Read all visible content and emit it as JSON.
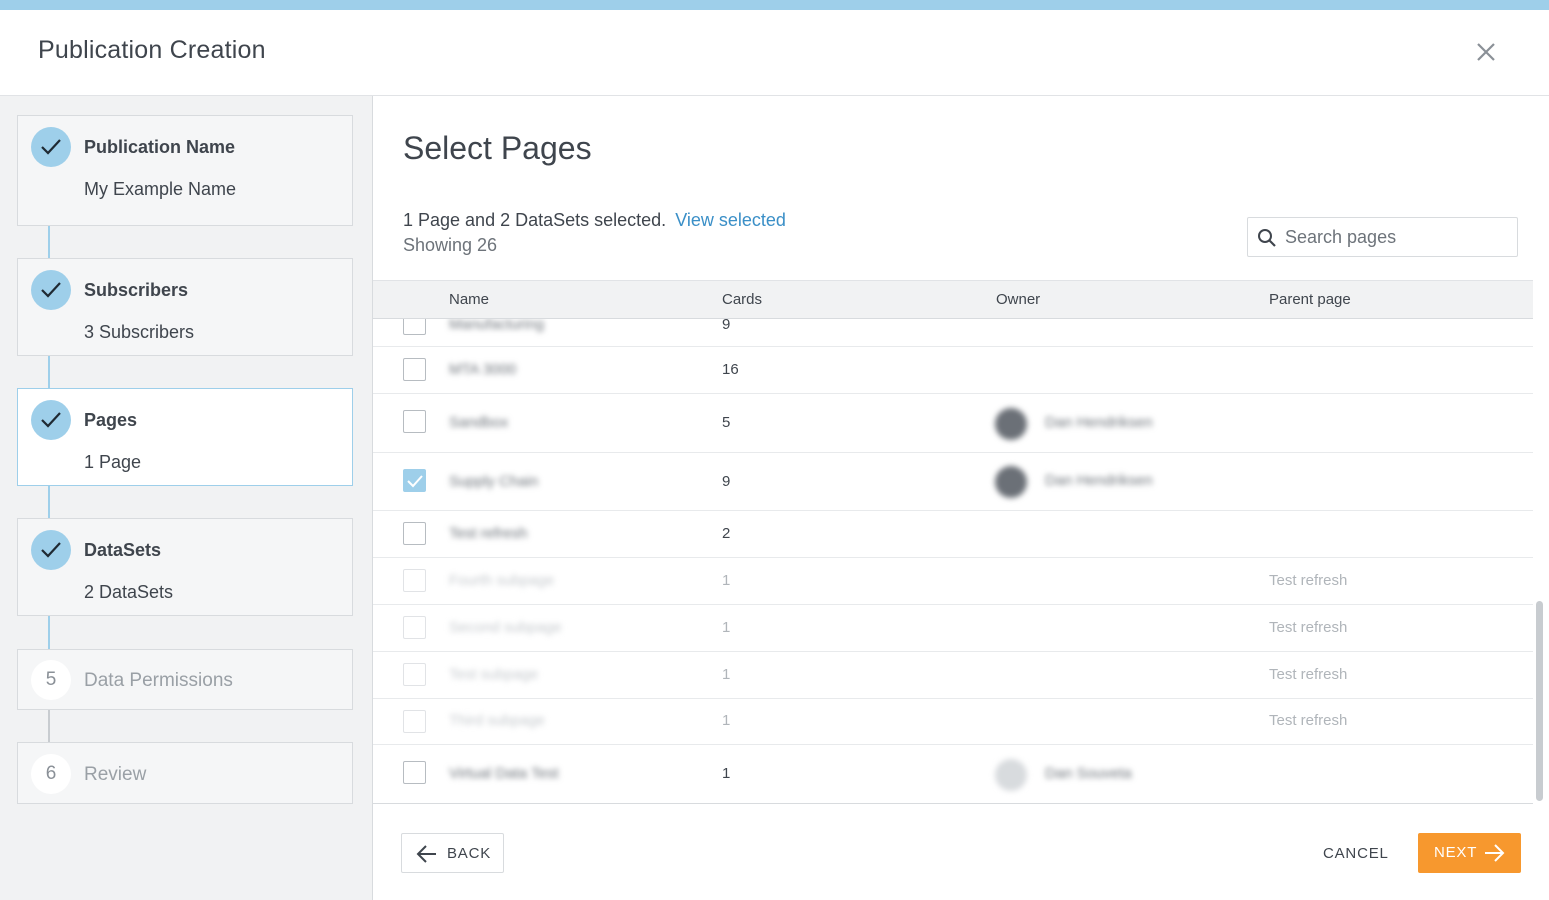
{
  "app": {
    "title": "Publication Creation",
    "close_icon": "close-icon"
  },
  "colors": {
    "accent": "#9ecfea",
    "link": "#3a8fc7",
    "primary_button": "#f7982e"
  },
  "steps": [
    {
      "status": "complete",
      "title": "Publication Name",
      "subtitle": "My Example Name"
    },
    {
      "status": "complete",
      "title": "Subscribers",
      "subtitle": "3 Subscribers"
    },
    {
      "status": "complete",
      "title": "Pages",
      "subtitle": "1 Page",
      "active": true
    },
    {
      "status": "complete",
      "title": "DataSets",
      "subtitle": "2 DataSets"
    },
    {
      "status": "pending",
      "number": "5",
      "title": "Data Permissions"
    },
    {
      "status": "pending",
      "number": "6",
      "title": "Review"
    }
  ],
  "main": {
    "title": "Select Pages",
    "selection_summary": "1 Page and 2 DataSets selected.",
    "view_selected_link": "View selected",
    "showing": "Showing 26",
    "search_placeholder": "Search pages"
  },
  "table": {
    "columns": [
      "Name",
      "Cards",
      "Owner",
      "Parent page"
    ],
    "rows": [
      {
        "name": "Manufacturing",
        "cards": "9",
        "owner": "",
        "parent": "",
        "checked": false
      },
      {
        "name": "MTA 3000",
        "cards": "16",
        "owner": "",
        "parent": "",
        "checked": false
      },
      {
        "name": "Sandbox",
        "cards": "5",
        "owner": "Dan Hendriksen",
        "parent": "",
        "checked": false
      },
      {
        "name": "Supply Chain",
        "cards": "9",
        "owner": "Dan Hendriksen",
        "parent": "",
        "checked": true
      },
      {
        "name": "Test refresh",
        "cards": "2",
        "owner": "",
        "parent": "",
        "checked": false
      },
      {
        "name": "Fourth subpage",
        "cards": "1",
        "owner": "",
        "parent": "Test refresh",
        "checked": false,
        "disabled": true
      },
      {
        "name": "Second subpage",
        "cards": "1",
        "owner": "",
        "parent": "Test refresh",
        "checked": false,
        "disabled": true
      },
      {
        "name": "Test subpage",
        "cards": "1",
        "owner": "",
        "parent": "Test refresh",
        "checked": false,
        "disabled": true
      },
      {
        "name": "Third subpage",
        "cards": "1",
        "owner": "",
        "parent": "Test refresh",
        "checked": false,
        "disabled": true
      },
      {
        "name": "Virtual Data Test",
        "cards": "1",
        "owner": "Dan Souveta",
        "parent": "",
        "checked": false
      }
    ]
  },
  "footer": {
    "back_label": "BACK",
    "cancel_label": "CANCEL",
    "next_label": "NEXT"
  }
}
